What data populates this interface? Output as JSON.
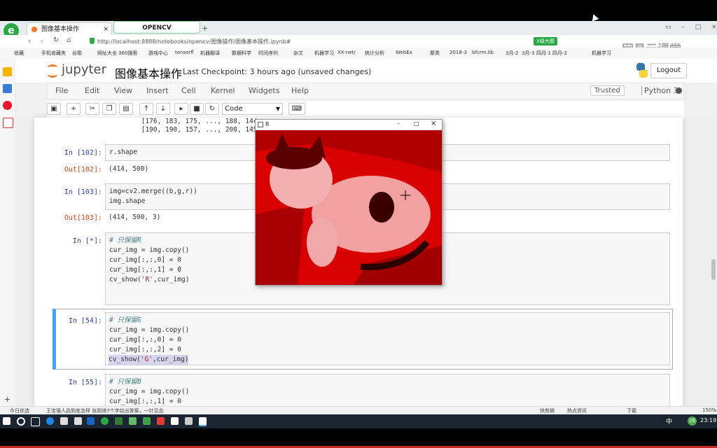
{
  "browser": {
    "tabs": [
      {
        "label": "图像基本操作",
        "close": "×"
      },
      {
        "label": "OPENCV"
      }
    ],
    "new_tab": "+",
    "address": "http://localhost:8888/notebooks/opencv/图像操作/图像基本操作.ipynb#",
    "address_host": "localhost",
    "badge": "X级大图",
    "bookmarks": [
      "收藏",
      "手机收藏夹",
      "谷歌",
      "网址大全",
      "360搜索",
      "游戏中心",
      "tensorfl",
      "机器翻译",
      "数据科学",
      "时间序列",
      "杂文",
      "机器学习",
      "XX-net/",
      "统计分析",
      "WebEx",
      "聚类",
      "2018-3",
      "bfcrm.lib",
      "3月-2",
      "3月-3",
      "四月-1",
      "四月-2",
      "机器学习"
    ],
    "watermark": "网易云课堂"
  },
  "jupyter": {
    "logo_text": "jupyter",
    "notebook_title": "图像基本操作",
    "checkpoint": "Last Checkpoint: 3 hours ago (unsaved changes)",
    "logout": "Logout",
    "menus": [
      "File",
      "Edit",
      "View",
      "Insert",
      "Cell",
      "Kernel",
      "Widgets",
      "Help"
    ],
    "trusted": "Trusted",
    "kernel": "Python 3",
    "cell_type": "Code"
  },
  "cells": {
    "out_top_1": " [176, 183, 175, ..., 188, 144,",
    "out_top_2": " [190, 190, 157, ..., 200, 145,",
    "c102_in": "In [102]:",
    "c102_code": "r.shape",
    "c102_out_label": "Out[102]:",
    "c102_out": "(414, 500)",
    "c103_in": "In [103]:",
    "c103_code_1": "img=cv2.merge((b,g,r))",
    "c103_code_2": "img.shape",
    "c103_out_label": "Out[103]:",
    "c103_out": "(414, 500, 3)",
    "cstar_in": "In [*]:",
    "cstar_l1": "# 只保留R",
    "cstar_l2": "cur_img = img.copy()",
    "cstar_l3": "cur_img[:,:,0] = 0",
    "cstar_l4": "cur_img[:,:,1] = 0",
    "cstar_l5a": "cv_show(",
    "cstar_l5b": "'R'",
    "cstar_l5c": ",cur_img)",
    "c54_in": "In [54]:",
    "c54_l1": "# 只保留G",
    "c54_l2": "cur_img = img.copy()",
    "c54_l3": "cur_img[:,:,0] = 0",
    "c54_l4": "cur_img[:,:,2] = 0",
    "c54_l5a": "cv_show(",
    "c54_l5b": "'G'",
    "c54_l5c": ",cur_img)",
    "c55_in": "In [55]:",
    "c55_l1": "# 只保留B",
    "c55_l2": "cur_img = img.copy()",
    "c55_l3": "cur_img[:,:,1] = 0"
  },
  "cv_window": {
    "title": "R",
    "minimize": "–",
    "maximize": "□",
    "close": "×"
  },
  "statusbar": {
    "left_1": "今日优选",
    "left_2": "王宝强人品到底怎样 张雨绮7个字给出答案，一针见血",
    "right_1": "快剪辑",
    "right_2": "热点资讯",
    "right_3": "下载",
    "zoom": "150%"
  },
  "taskbar": {
    "time": "23:19",
    "ime": "中",
    "badge": "26"
  },
  "colors": {
    "jupyter_orange": "#f37726",
    "cell_selected": "#42a5f5",
    "red_channel": "#e00000"
  }
}
